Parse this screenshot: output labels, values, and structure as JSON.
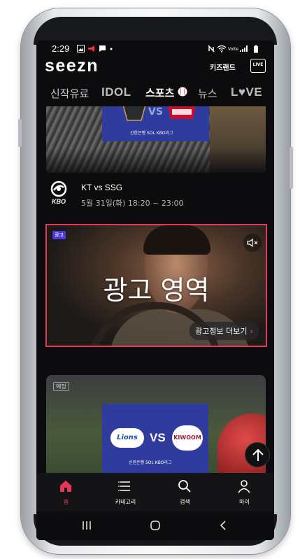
{
  "status": {
    "time": "2:29"
  },
  "header": {
    "logo": "seezn",
    "kids_land": "키즈랜드",
    "live_label": "LIVE"
  },
  "tabs": [
    {
      "label": "신작유료",
      "active": false
    },
    {
      "label": "IDOL",
      "active": false
    },
    {
      "label": "스포츠",
      "active": true
    },
    {
      "label": "뉴스",
      "active": false
    },
    {
      "label": "L♥VE",
      "active": false
    }
  ],
  "game": {
    "league": "KBO",
    "title": "KT vs SSG",
    "datetime": "5월 31일(화) 18:20 ~ 23:00",
    "banner_vs": "VS",
    "sponsor": "신한은행 SOL KBO리그"
  },
  "ad": {
    "badge": "광고",
    "area_label": "광고 영역",
    "more_label": "광고정보 더보기",
    "accent": "#e8365b"
  },
  "scheduled": {
    "badge": "예정",
    "team_left": "Lions",
    "vs": "VS",
    "team_right": "KIWOOM",
    "sponsor": "신한은행 SOL KBO리그"
  },
  "bottom_nav": [
    {
      "label": "홈",
      "icon": "home-icon",
      "active": true
    },
    {
      "label": "카테고리",
      "icon": "list-icon",
      "active": false
    },
    {
      "label": "검색",
      "icon": "search-icon",
      "active": false
    },
    {
      "label": "마이",
      "icon": "person-icon",
      "active": false
    }
  ]
}
